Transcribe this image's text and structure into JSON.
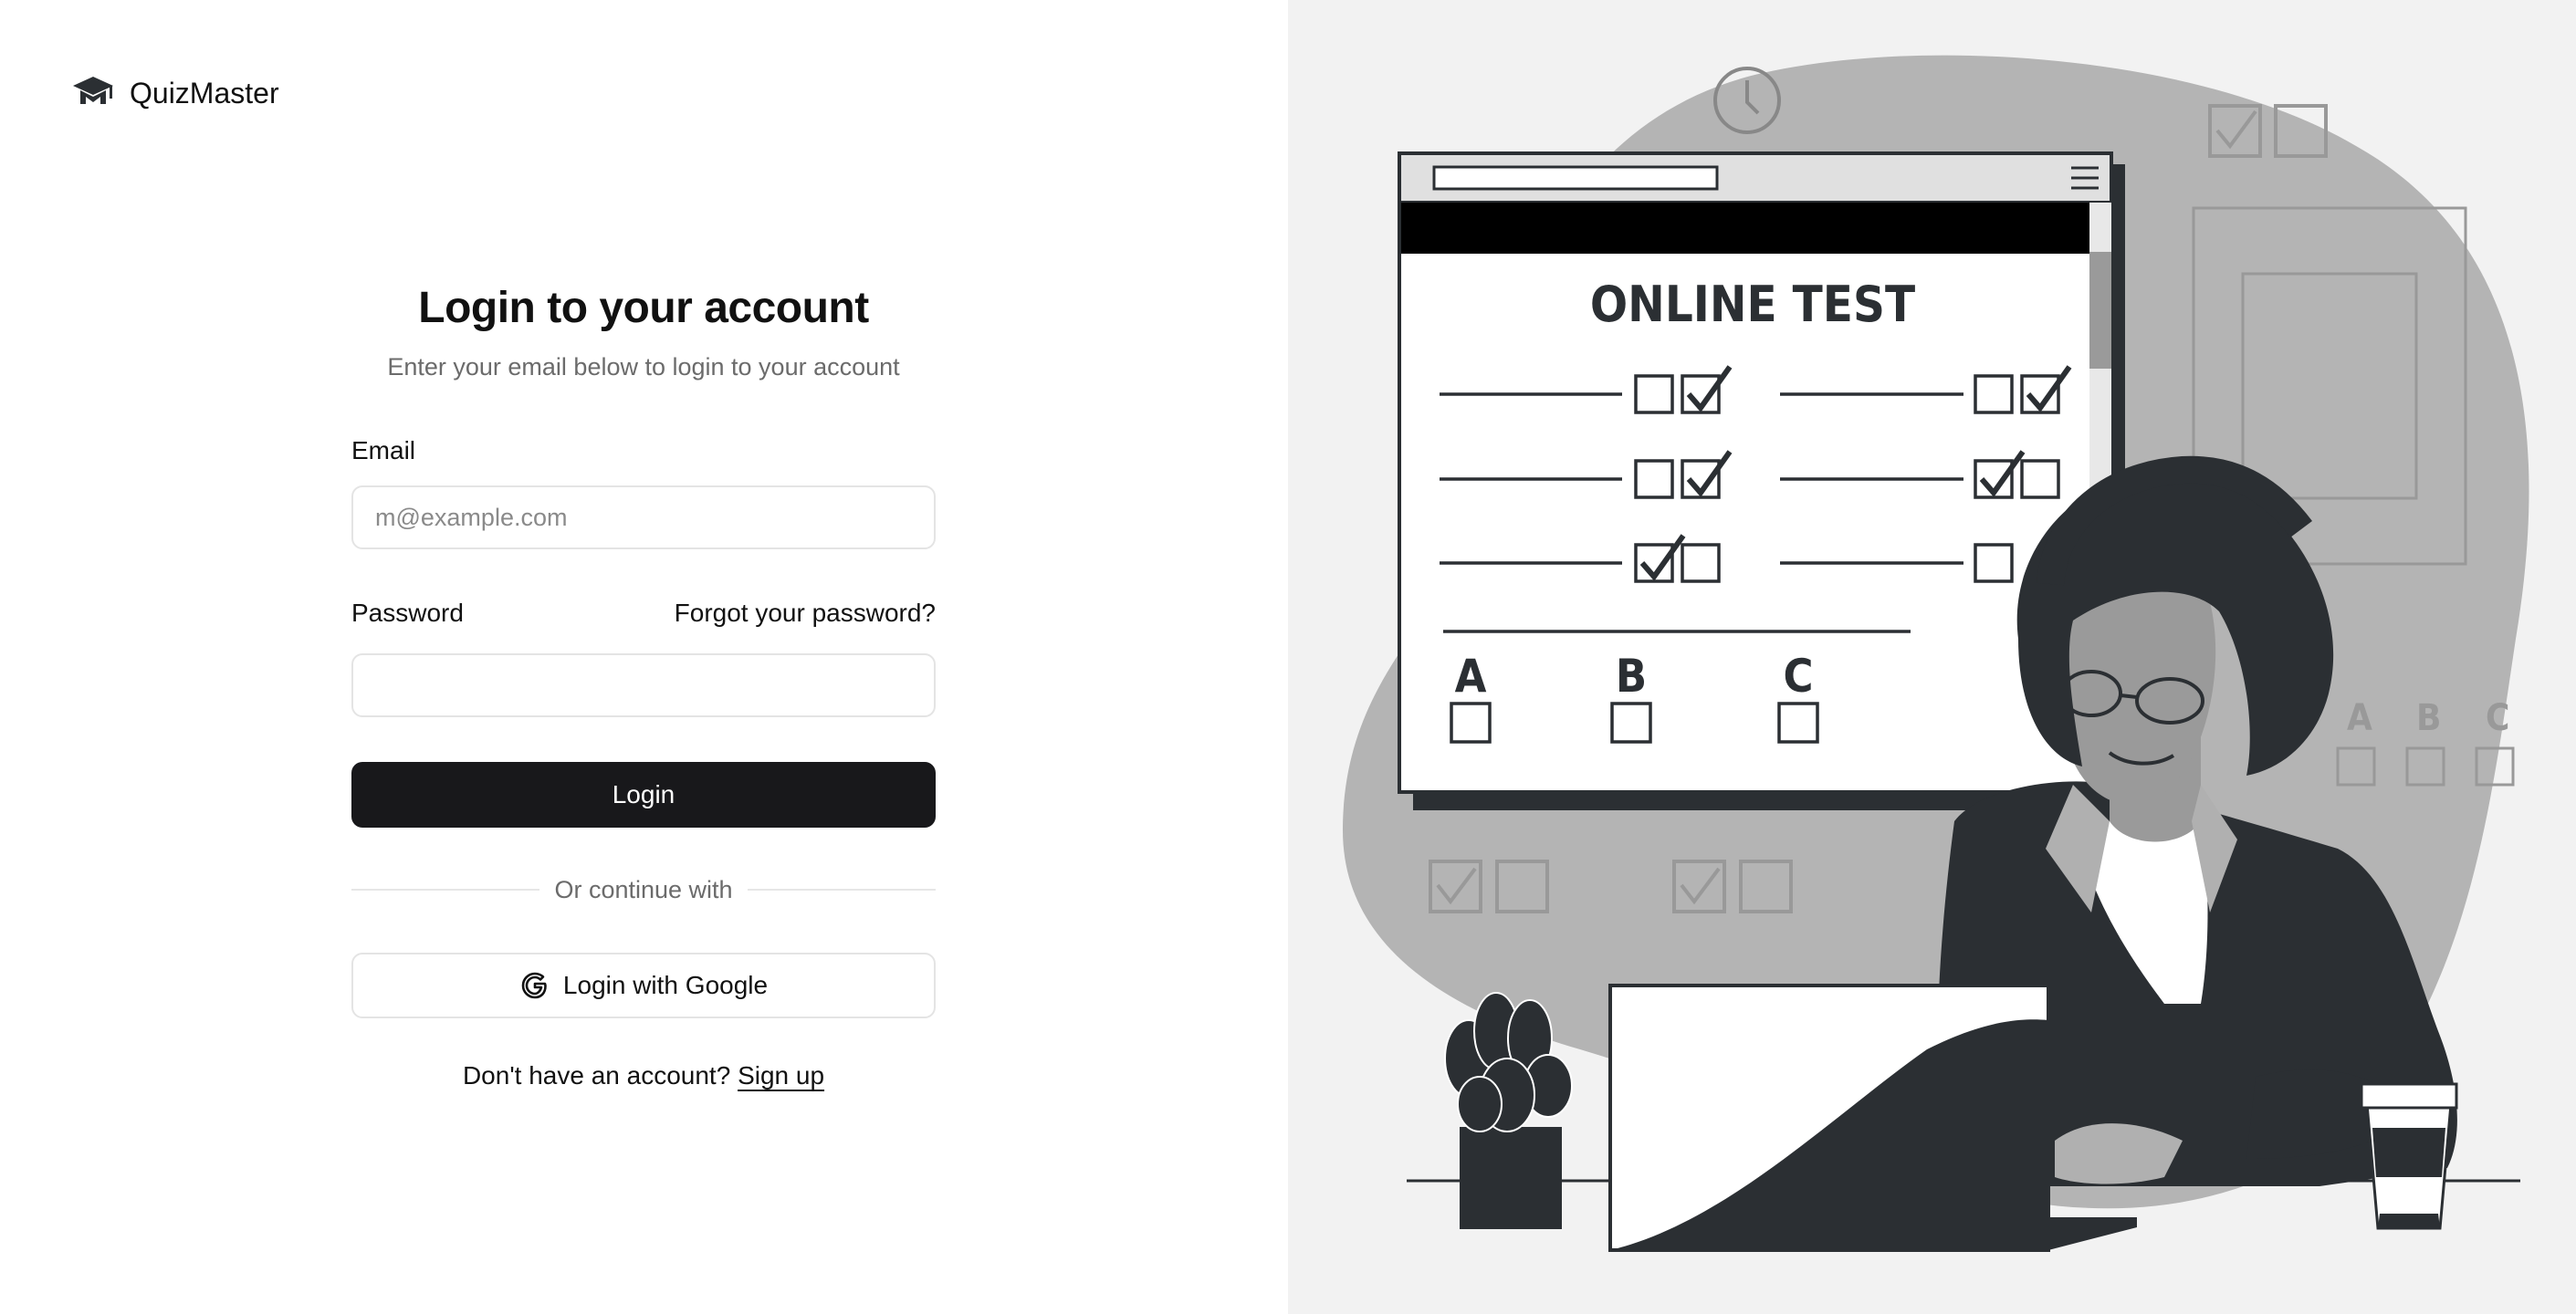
{
  "brand": {
    "name": "QuizMaster",
    "icon": "graduation-cap-icon"
  },
  "login": {
    "title": "Login to your account",
    "subtitle": "Enter your email below to login to your account",
    "email_label": "Email",
    "email_placeholder": "m@example.com",
    "email_value": "",
    "password_label": "Password",
    "password_value": "",
    "forgot_link": "Forgot your password?",
    "submit_label": "Login",
    "divider_text": "Or continue with",
    "google_label": "Login with Google",
    "google_icon": "google-icon",
    "signup_prompt": "Don't have an account?",
    "signup_link": "Sign up"
  },
  "illustration": {
    "screen_title": "ONLINE TEST",
    "choices": [
      "A",
      "B",
      "C"
    ],
    "side_choices": [
      "A",
      "B",
      "C"
    ]
  },
  "colors": {
    "primary_button": "#18181b",
    "illustration_bg": "#f2f2f2",
    "blob": "#b4b4b4",
    "ink": "#2b2f33"
  }
}
